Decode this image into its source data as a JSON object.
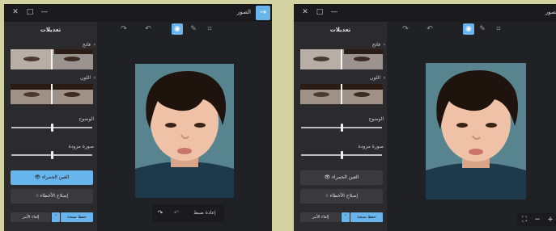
{
  "windows": [
    {
      "app_title": "الصور",
      "window_controls": {
        "minimize": "—",
        "maximize": "□",
        "close": "✕"
      },
      "back_icon": "arrow-right-icon",
      "toolbar": [
        "crop-icon",
        "markup-icon",
        "adjust-icon",
        "undo-icon",
        "redo-icon"
      ],
      "panel": {
        "title": "تعديلات",
        "sections": [
          {
            "label": "فاتح",
            "chevron": "›"
          },
          {
            "label": "اللون",
            "chevron": "›"
          }
        ],
        "sliders": [
          {
            "label": "الوضوح",
            "value": 0.5
          },
          {
            "label": "صورة مزودة",
            "value": 0.5
          }
        ],
        "red_eye_label": "العين الحمراء",
        "spot_fix_label": "إصلاح الأخطاء",
        "save_copy_label": "حفظ نسخة",
        "dropdown_chevron": "˅",
        "cancel_label": "إلغاء الأمر"
      },
      "overlay": {
        "reset_label": "إعادة ضبط",
        "undo_icon": "undo-icon",
        "redo_icon": "redo-icon"
      }
    },
    {
      "app_title": "الصور",
      "window_controls": {
        "minimize": "—",
        "maximize": "□",
        "close": "✕"
      },
      "back_icon": "arrow-right-icon",
      "toolbar": [
        "crop-icon",
        "markup-icon",
        "adjust-icon",
        "undo-icon",
        "redo-icon"
      ],
      "panel": {
        "title": "تعديلات",
        "sections": [
          {
            "label": "فاتح",
            "chevron": "›"
          },
          {
            "label": "اللون",
            "chevron": "›"
          }
        ],
        "sliders": [
          {
            "label": "الوضوح",
            "value": 0.5
          },
          {
            "label": "صورة مزودة",
            "value": 0.5
          }
        ],
        "red_eye_label": "العين الحمراء",
        "spot_fix_label": "إصلاح الأخطاء",
        "save_copy_label": "حفظ نسخة",
        "dropdown_chevron": "˅",
        "cancel_label": "إلغاء الأمر"
      },
      "zoom": {
        "fit_icon": "fit-to-window-icon",
        "zoom_out": "−",
        "zoom_in": "+"
      }
    }
  ],
  "colors": {
    "accent": "#68b4ec",
    "background": "#202124",
    "panel": "#2b2b2e",
    "frame": "#d2d2a2"
  }
}
